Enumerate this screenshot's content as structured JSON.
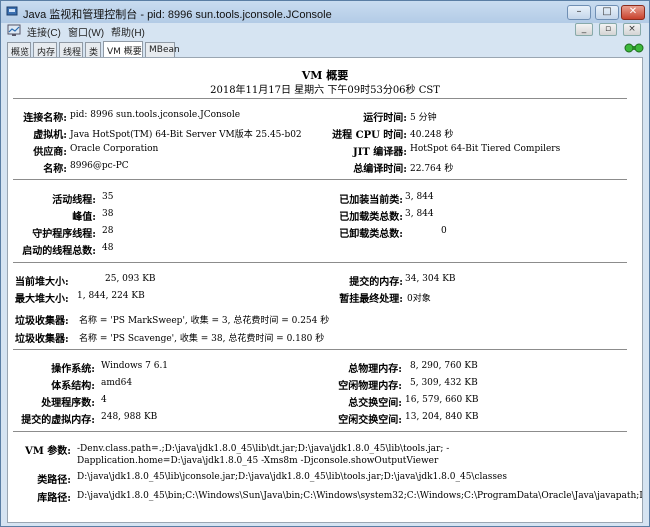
{
  "window": {
    "title": "Java 监视和管理控制台 - pid: 8996 sun.tools.jconsole.JConsole",
    "min_btn": "–",
    "max_btn": "□",
    "close_btn": "✕"
  },
  "menubar": {
    "items": [
      "连接(C)",
      "窗口(W)",
      "帮助(H)"
    ],
    "inner_min": "_",
    "inner_max": "▫",
    "inner_close": "×"
  },
  "tabs": [
    "概览",
    "内存",
    "线程",
    "类",
    "VM 概要",
    "MBean"
  ],
  "selected_tab": "VM 概要",
  "header": {
    "title": "VM 概要",
    "datetime": "2018年11月17日 星期六 下午09时53分06秒 CST"
  },
  "section1": {
    "left": [
      {
        "label": "连接名称:",
        "value": "pid: 8996 sun.tools.jconsole.JConsole"
      },
      {
        "label": "虚拟机:",
        "value": "Java HotSpot(TM) 64-Bit Server VM版本 25.45-b02"
      },
      {
        "label": "供应商:",
        "value": "Oracle Corporation"
      },
      {
        "label": "名称:",
        "value": "8996@pc-PC"
      }
    ],
    "right": [
      {
        "label": "运行时间:",
        "value": "5 分钟"
      },
      {
        "label": "进程 CPU 时间:",
        "value": "40.248 秒"
      },
      {
        "label": "JIT 编译器:",
        "value": "HotSpot 64-Bit Tiered Compilers"
      },
      {
        "label": "总编译时间:",
        "value": "22.764 秒"
      }
    ]
  },
  "section2": {
    "left": [
      {
        "label": "活动线程:",
        "value": "35"
      },
      {
        "label": "峰值:",
        "value": "38"
      },
      {
        "label": "守护程序线程:",
        "value": "28"
      },
      {
        "label": "启动的线程总数:",
        "value": "48"
      }
    ],
    "right": [
      {
        "label": "已加装当前类:",
        "value": "3, 844"
      },
      {
        "label": "已加载类总数:",
        "value": "3, 844"
      },
      {
        "label": "已卸载类总数:",
        "value": "0"
      }
    ]
  },
  "section3": {
    "heap_label": "当前堆大小:",
    "heap_value": "25, 093 KB",
    "maxheap_label": "最大堆大小:",
    "maxheap_value": "1, 844, 224 KB",
    "committed_label": "提交的内存:",
    "committed_value": "34, 304 KB",
    "pending_label": "暂挂最终处理:",
    "pending_value": "0对象",
    "gc": [
      {
        "label": "垃圾收集器:",
        "value": "名称 = 'PS MarkSweep', 收集 = 3, 总花费时间 = 0.254 秒"
      },
      {
        "label": "垃圾收集器:",
        "value": "名称 = 'PS Scavenge', 收集 = 38, 总花费时间 = 0.180 秒"
      }
    ]
  },
  "section4": {
    "left": [
      {
        "label": "操作系统:",
        "value": "Windows 7 6.1"
      },
      {
        "label": "体系结构:",
        "value": "amd64"
      },
      {
        "label": "处理程序数:",
        "value": "4"
      },
      {
        "label": "提交的虚拟内存:",
        "value": "248, 988 KB"
      }
    ],
    "right": [
      {
        "label": "总物理内存:",
        "value": "8, 290, 760 KB"
      },
      {
        "label": "空闲物理内存:",
        "value": "5, 309, 432 KB"
      },
      {
        "label": "总交换空间:",
        "value": "16, 579, 660 KB"
      },
      {
        "label": "空闲交换空间:",
        "value": "13, 204, 840 KB"
      }
    ]
  },
  "section5": {
    "vmargs_label": "VM 参数:",
    "vmargs_value": "-Denv.class.path=.;D:\\java\\jdk1.8.0_45\\lib\\dt.jar;D:\\java\\jdk1.8.0_45\\lib\\tools.jar; -Dapplication.home=D:\\java\\jdk1.8.0_45 -Xms8m -Djconsole.showOutputViewer",
    "classpath_label": "类路径:",
    "classpath_value": "D:\\java\\jdk1.8.0_45\\lib\\jconsole.jar;D:\\java\\jdk1.8.0_45\\lib\\tools.jar;D:\\java\\jdk1.8.0_45\\classes",
    "libpath_label": "库路径:",
    "libpath_value": "D:\\java\\jdk1.8.0_45\\bin;C:\\Windows\\Sun\\Java\\bin;C:\\Windows\\system32;C:\\Windows;C:\\ProgramData\\Oracle\\Java\\javapath;D:\\java\\jdk1.8.0_45\\bin;D:\\java\\jdk1.8.0_45\\jre\\bin;C:\\Windows\\system32;C:\\Windows;C:\\Windows\\System32\\Wbem;C:\\Windows\\System32\\WindowsPowerShell\\v1.0\\;D:"
  },
  "colors": {
    "accent": "#c8412d",
    "panel": "#ffffff",
    "chrome": "#d6e4f2"
  }
}
